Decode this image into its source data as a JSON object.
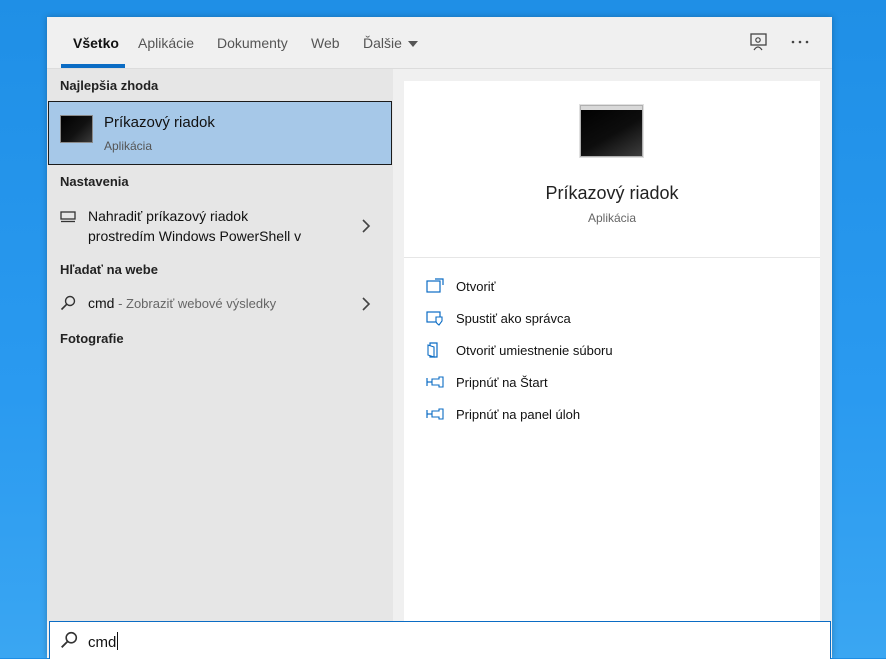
{
  "tabs": [
    {
      "label": "Všetko",
      "active": true
    },
    {
      "label": "Aplikácie"
    },
    {
      "label": "Dokumenty"
    },
    {
      "label": "Web"
    },
    {
      "label": "Ďalšie"
    }
  ],
  "top_icons": [
    "feedback-icon",
    "more-icon"
  ],
  "left": {
    "best_match_title": "Najlepšia zhoda",
    "best_match": {
      "title": "Príkazový riadok",
      "subtitle": "Aplikácia"
    },
    "settings_title": "Nastavenia",
    "settings_item": {
      "line1": "Nahradiť príkazový riadok",
      "line2": "prostredím Windows PowerShell v"
    },
    "web_title": "Hľadať na webe",
    "web_item": {
      "query": "cmd",
      "suffix": " - Zobraziť webové výsledky"
    },
    "photos_title": "Fotografie"
  },
  "preview": {
    "title": "Príkazový riadok",
    "subtitle": "Aplikácia",
    "actions": [
      {
        "label": "Otvoriť",
        "icon": "open-icon"
      },
      {
        "label": "Spustiť ako správca",
        "icon": "shield-icon"
      },
      {
        "label": "Otvoriť umiestnenie súboru",
        "icon": "folder-icon"
      },
      {
        "label": "Pripnúť na Štart",
        "icon": "pin-icon"
      },
      {
        "label": "Pripnúť na panel úloh",
        "icon": "pin-icon"
      }
    ]
  },
  "search": {
    "value": "cmd"
  },
  "colors": {
    "accent": "#0b6cc4",
    "selected": "#a6c8e8",
    "desktop": "#2a9af0"
  }
}
